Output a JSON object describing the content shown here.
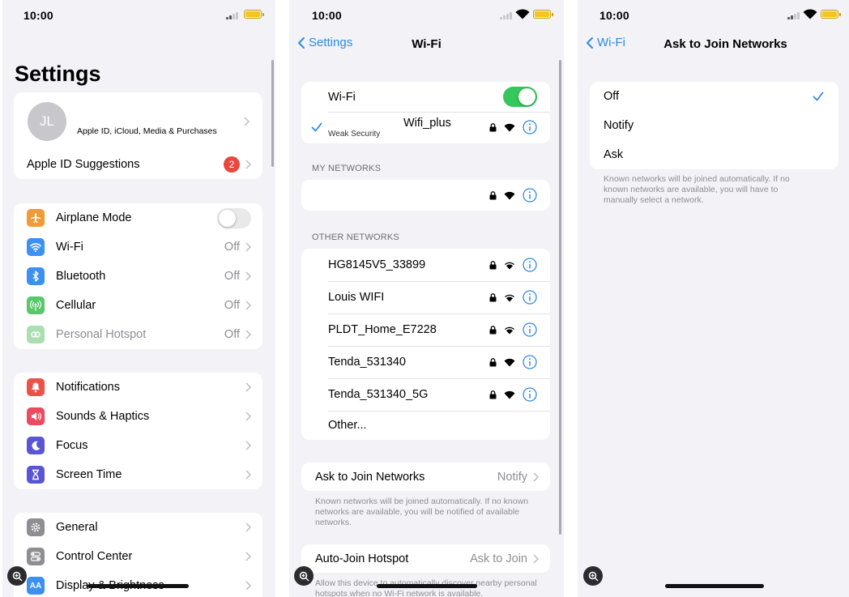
{
  "status": {
    "time": "10:00"
  },
  "settings": {
    "title": "Settings",
    "profile": {
      "initials": "JL",
      "subtitle": "Apple ID, iCloud, Media & Purchases"
    },
    "suggestions": {
      "label": "Apple ID Suggestions",
      "badge": "2"
    },
    "connectivity": [
      {
        "label": "Airplane Mode",
        "value": "",
        "icon": "airplane-icon",
        "color": "#f29a37"
      },
      {
        "label": "Wi-Fi",
        "value": "Off",
        "icon": "wifi-icon",
        "color": "#3d8ff0"
      },
      {
        "label": "Bluetooth",
        "value": "Off",
        "icon": "bluetooth-icon",
        "color": "#3d8ff0"
      },
      {
        "label": "Cellular",
        "value": "Off",
        "icon": "cellular-icon",
        "color": "#59c86a"
      },
      {
        "label": "Personal Hotspot",
        "value": "Off",
        "icon": "hotspot-icon",
        "color": "#a9dfb1"
      }
    ],
    "notifications_group": [
      {
        "label": "Notifications",
        "icon": "bell-icon",
        "color": "#ed5249"
      },
      {
        "label": "Sounds & Haptics",
        "icon": "speaker-icon",
        "color": "#ec4b5f"
      },
      {
        "label": "Focus",
        "icon": "moon-icon",
        "color": "#5856d6"
      },
      {
        "label": "Screen Time",
        "icon": "hourglass-icon",
        "color": "#5856d6"
      }
    ],
    "general_group": [
      {
        "label": "General",
        "icon": "gear-icon",
        "color": "#8e8e93"
      },
      {
        "label": "Control Center",
        "icon": "switches-icon",
        "color": "#8e8e93"
      },
      {
        "label": "Display & Brightness",
        "icon": "text-size-icon",
        "color": "#3d8ff0",
        "glyph": "AA"
      }
    ]
  },
  "wifi": {
    "back_label": "Settings",
    "title": "Wi-Fi",
    "toggle_label": "Wi-Fi",
    "connected": {
      "name": "Wifi_plus",
      "note": "Weak Security"
    },
    "my_networks_header": "MY NETWORKS",
    "other_networks_header": "OTHER NETWORKS",
    "networks": [
      {
        "name": "HG8145V5_33899"
      },
      {
        "name": "Louis WIFI"
      },
      {
        "name": "PLDT_Home_E7228"
      },
      {
        "name": "Tenda_531340"
      },
      {
        "name": "Tenda_531340_5G"
      }
    ],
    "other_label": "Other...",
    "ask_label": "Ask to Join Networks",
    "ask_value": "Notify",
    "ask_footer": "Known networks will be joined automatically. If no known networks are available, you will be notified of available networks.",
    "hotspot_label": "Auto-Join Hotspot",
    "hotspot_value": "Ask to Join",
    "hotspot_footer": "Allow this device to automatically discover nearby personal hotspots when no Wi-Fi network is available."
  },
  "ask": {
    "back_label": "Wi-Fi",
    "title": "Ask to Join Networks",
    "options": [
      "Off",
      "Notify",
      "Ask"
    ],
    "selected": "Off",
    "footer": "Known networks will be joined automatically. If no known networks are available, you will have to manually select a network."
  },
  "colors": {
    "accent": "#2f8ae0",
    "toggle_on": "#34c759",
    "badge": "#e8483d"
  }
}
